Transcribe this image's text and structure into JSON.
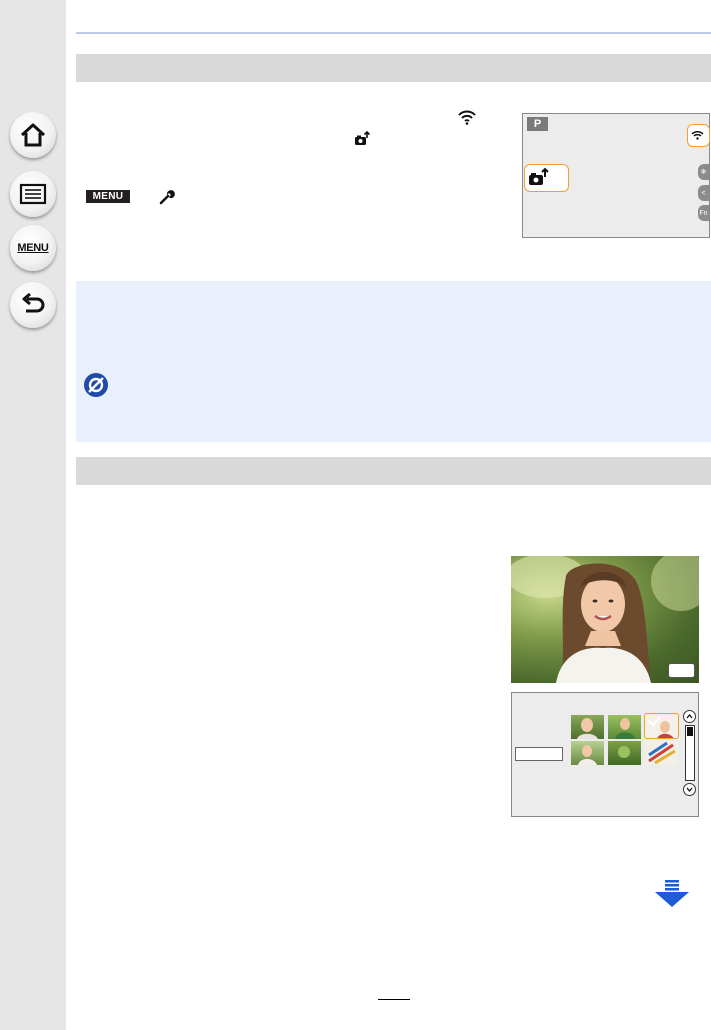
{
  "sidebar": {
    "items": [
      {
        "name": "home",
        "icon": "home-icon"
      },
      {
        "name": "contents",
        "icon": "list-icon"
      },
      {
        "name": "menu",
        "icon": "menu-icon",
        "label": "MENU"
      },
      {
        "name": "back",
        "icon": "back-arrow-icon"
      }
    ]
  },
  "instructions": {
    "menu_badge": "MENU",
    "wrench_icon": "wrench-icon",
    "wifi_icon": "wifi-icon",
    "camera_send_icon": "camera-send-icon"
  },
  "camera_screen": {
    "mode_badge": "P",
    "side_tabs": [
      "❄",
      "<",
      "Fn"
    ]
  },
  "thumbnail_screen": {
    "scroll_up": "⌃",
    "scroll_down": "⌄"
  },
  "colors": {
    "highlight": "#f0a030",
    "panel_blue": "#eaf0fb",
    "section_gray": "#d9d9d9",
    "arrow_blue": "#1f5bd6"
  }
}
